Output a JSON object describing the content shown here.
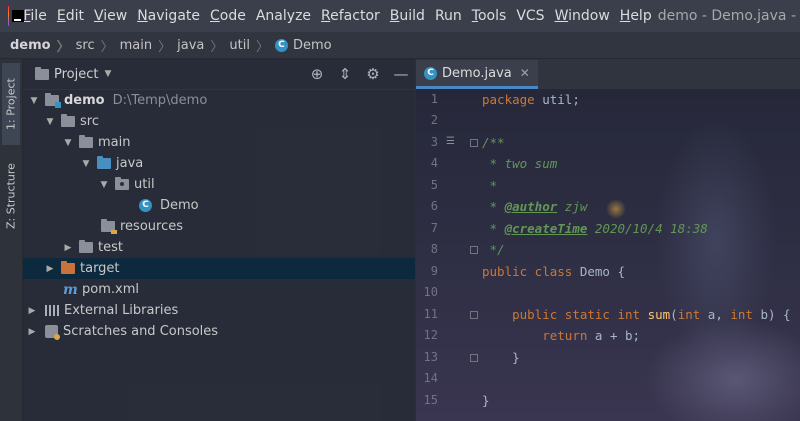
{
  "menu": {
    "items": [
      {
        "mn": "F",
        "rest": "ile"
      },
      {
        "mn": "E",
        "rest": "dit"
      },
      {
        "mn": "V",
        "rest": "iew"
      },
      {
        "mn": "N",
        "rest": "avigate"
      },
      {
        "mn": "C",
        "rest": "ode"
      },
      {
        "mn": "",
        "rest": "Analyze"
      },
      {
        "mn": "R",
        "rest": "efactor"
      },
      {
        "mn": "B",
        "rest": "uild"
      },
      {
        "mn": "",
        "rest": "Run"
      },
      {
        "mn": "T",
        "rest": "ools"
      },
      {
        "mn": "",
        "rest": "VCS"
      },
      {
        "mn": "W",
        "rest": "indow"
      },
      {
        "mn": "H",
        "rest": "elp"
      }
    ],
    "window_title": "demo - Demo.java -"
  },
  "breadcrumb": [
    "demo",
    "src",
    "main",
    "java",
    "util",
    "Demo"
  ],
  "side_tabs": {
    "project": "1: Project",
    "structure": "Z: Structure"
  },
  "project_panel": {
    "title": "Project",
    "tree": [
      {
        "label": "demo",
        "extra": "D:\\Temp\\demo"
      },
      {
        "label": "src"
      },
      {
        "label": "main"
      },
      {
        "label": "java"
      },
      {
        "label": "util"
      },
      {
        "label": "Demo"
      },
      {
        "label": "resources"
      },
      {
        "label": "test"
      },
      {
        "label": "target"
      },
      {
        "label": "pom.xml"
      },
      {
        "label": "External Libraries"
      },
      {
        "label": "Scratches and Consoles"
      }
    ]
  },
  "editor": {
    "tab_label": "Demo.java",
    "line_numbers": [
      "1",
      "2",
      "3",
      "4",
      "5",
      "6",
      "7",
      "8",
      "9",
      "10",
      "11",
      "12",
      "13",
      "14",
      "15"
    ],
    "code": {
      "l1_kw": "package",
      "l1_rest": " util;",
      "l3": "/**",
      "l4": " * two sum",
      "l5": " *",
      "l6_pre": " * ",
      "l6_tag": "@author",
      "l6_post": " zjw",
      "l7_pre": " * ",
      "l7_tag": "@createTime",
      "l7_post": " 2020/10/4 18:38",
      "l8": " */",
      "l9_kw": "public class",
      "l9_cls": " Demo {",
      "l11_indent": "    ",
      "l11_kw1": "public static int",
      "l11_fn": " sum",
      "l11_p1": "(",
      "l11_kw2": "int",
      "l11_p2": " a, ",
      "l11_kw3": "int",
      "l11_p3": " b) {",
      "l12_indent": "        ",
      "l12_kw": "return",
      "l12_rest": " a + b;",
      "l13": "    }",
      "l15": "}"
    }
  }
}
